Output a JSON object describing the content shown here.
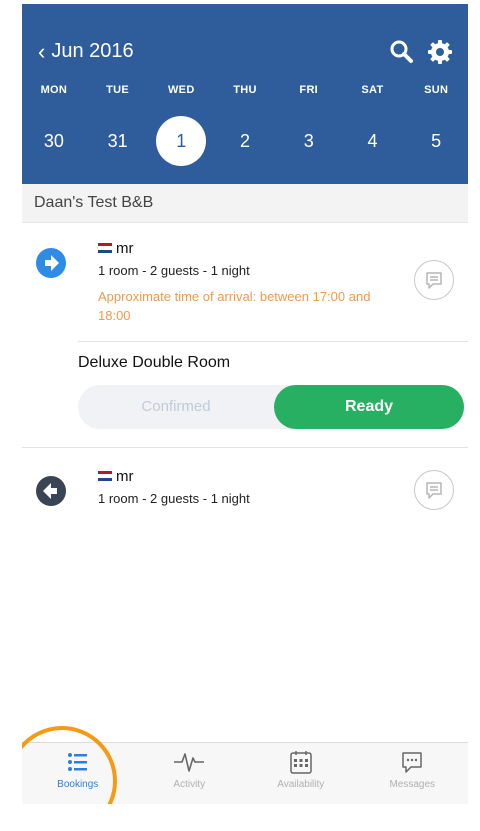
{
  "header": {
    "month_label": "Jun 2016",
    "days": [
      "MON",
      "TUE",
      "WED",
      "THU",
      "FRI",
      "SAT",
      "SUN"
    ],
    "dates": [
      "30",
      "31",
      "1",
      "2",
      "3",
      "4",
      "5"
    ],
    "selected_index": 2
  },
  "property": {
    "name": "Daan's Test B&B"
  },
  "bookings": [
    {
      "direction": "arrival",
      "guest": "mr",
      "summary": "1 room - 2 guests - 1 night",
      "arrival_note": "Approximate time of arrival: between 17:00 and 18:00",
      "room_type": "Deluxe Double Room",
      "status_options": [
        "Confirmed",
        "Ready"
      ],
      "status_selected": "Ready"
    },
    {
      "direction": "departure",
      "guest": "mr",
      "summary": "1 room - 2 guests - 1 night"
    }
  ],
  "tabs": [
    {
      "label": "Bookings",
      "icon": "list-icon",
      "active": true
    },
    {
      "label": "Activity",
      "icon": "pulse-icon",
      "active": false
    },
    {
      "label": "Availability",
      "icon": "calendar-icon",
      "active": false
    },
    {
      "label": "Messages",
      "icon": "chat-icon",
      "active": false
    }
  ],
  "colors": {
    "header": "#2f5d9b",
    "arrival_icon": "#2f8ce6",
    "departure_icon": "#394455",
    "ready": "#27b062",
    "arrival_text": "#f2994a",
    "active_tab": "#2f7fd7",
    "highlight": "#f59a13"
  }
}
